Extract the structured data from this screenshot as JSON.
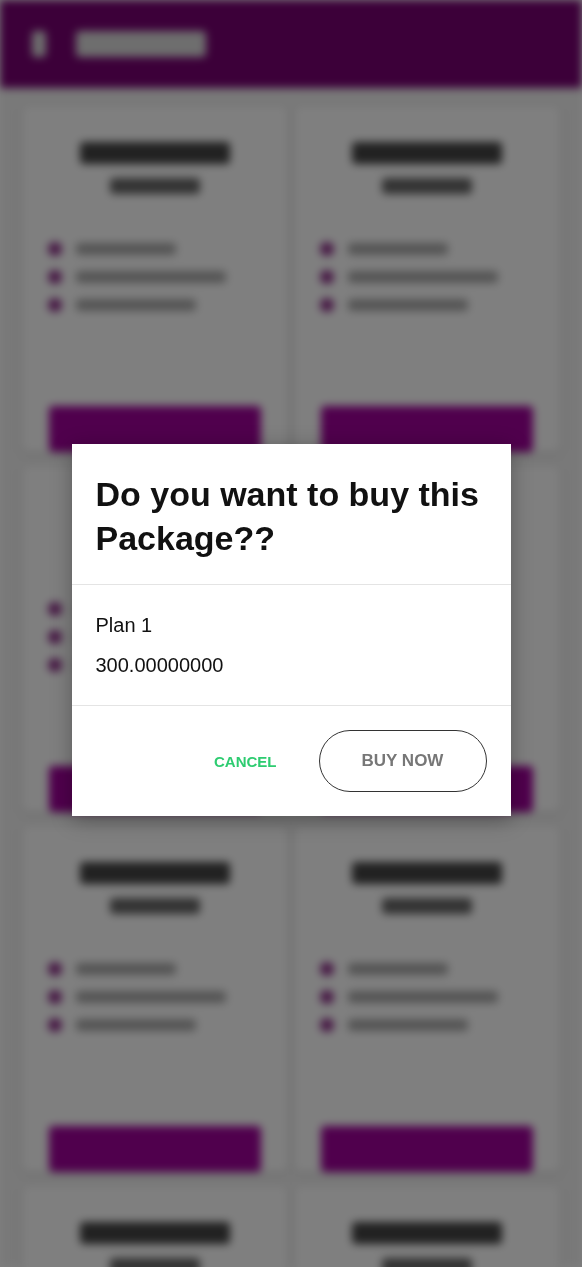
{
  "dialog": {
    "title": "Do you want to buy this Package??",
    "lines": [
      "Plan 1",
      "300.00000000"
    ],
    "actions": [
      {
        "label": "CANCEL",
        "kind": "text"
      },
      {
        "label": "BUY NOW",
        "kind": "outlined"
      }
    ]
  }
}
